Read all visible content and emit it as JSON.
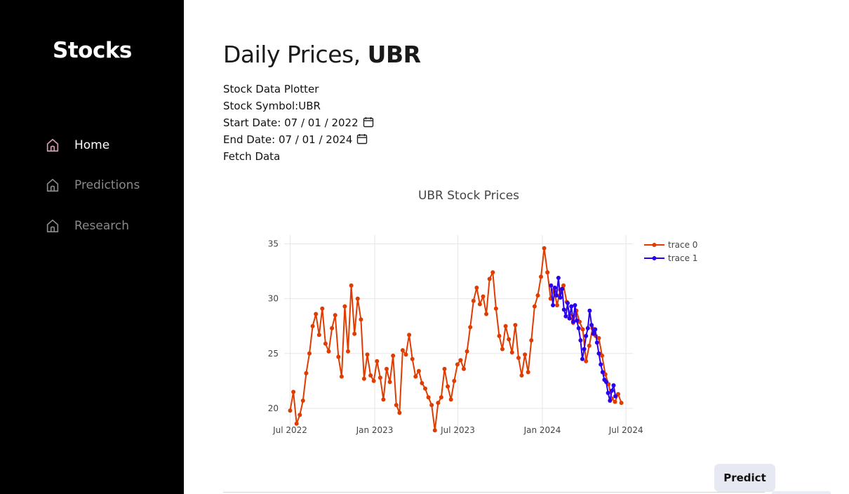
{
  "sidebar": {
    "brand": "Stocks",
    "items": [
      {
        "label": "Home",
        "icon": "home-icon",
        "active": true
      },
      {
        "label": "Predictions",
        "icon": "home-icon",
        "active": false
      },
      {
        "label": "Research",
        "icon": "home-icon",
        "active": false
      }
    ],
    "colors": {
      "background": "#000000",
      "active_icon": "#d79bb4",
      "inactive": "#8a8a8a"
    }
  },
  "main": {
    "title_prefix": "Daily Prices, ",
    "title_symbol": "UBR",
    "plotter_label": "Stock Data Plotter",
    "symbol_label": "Stock Symbol:UBR",
    "start_label": "Start Date: ",
    "start_value": "07 / 01 / 2022",
    "end_label": "End Date: ",
    "end_value": "07 / 01 / 2024",
    "fetch_label": "Fetch Data",
    "predict_label": "Predict"
  },
  "chart_data": {
    "type": "line",
    "title": "UBR Stock Prices",
    "xlabel": "",
    "ylabel": "",
    "ylim": [
      17.5,
      35.8
    ],
    "xlim": [
      "2022-06-18",
      "2024-07-16"
    ],
    "x_ticks": [
      "Jul 2022",
      "Jan 2023",
      "Jul 2023",
      "Jan 2024",
      "Jul 2024"
    ],
    "x_tick_dates": [
      "2022-07-01",
      "2023-01-01",
      "2023-07-01",
      "2024-01-01",
      "2024-07-01"
    ],
    "y_ticks": [
      20,
      25,
      30,
      35
    ],
    "grid": true,
    "legend_position": "top-right",
    "mode": "lines+markers",
    "series": [
      {
        "name": "trace 0",
        "color": "#e03c00",
        "points": [
          [
            "2022-07-01",
            19.8
          ],
          [
            "2022-07-08",
            21.5
          ],
          [
            "2022-07-15",
            18.6
          ],
          [
            "2022-07-22",
            19.4
          ],
          [
            "2022-07-29",
            20.7
          ],
          [
            "2022-08-05",
            23.2
          ],
          [
            "2022-08-12",
            25.0
          ],
          [
            "2022-08-19",
            27.5
          ],
          [
            "2022-08-26",
            28.6
          ],
          [
            "2022-09-02",
            26.7
          ],
          [
            "2022-09-09",
            29.1
          ],
          [
            "2022-09-16",
            25.9
          ],
          [
            "2022-09-23",
            25.2
          ],
          [
            "2022-09-30",
            27.3
          ],
          [
            "2022-10-07",
            28.5
          ],
          [
            "2022-10-14",
            24.7
          ],
          [
            "2022-10-21",
            22.9
          ],
          [
            "2022-10-28",
            29.3
          ],
          [
            "2022-11-04",
            25.2
          ],
          [
            "2022-11-11",
            31.2
          ],
          [
            "2022-11-18",
            26.8
          ],
          [
            "2022-11-25",
            30.0
          ],
          [
            "2022-12-02",
            28.1
          ],
          [
            "2022-12-09",
            22.7
          ],
          [
            "2022-12-16",
            24.9
          ],
          [
            "2022-12-23",
            23.0
          ],
          [
            "2022-12-30",
            22.5
          ],
          [
            "2023-01-06",
            24.3
          ],
          [
            "2023-01-13",
            22.8
          ],
          [
            "2023-01-20",
            20.8
          ],
          [
            "2023-01-27",
            23.6
          ],
          [
            "2023-02-03",
            22.4
          ],
          [
            "2023-02-10",
            24.8
          ],
          [
            "2023-02-17",
            20.3
          ],
          [
            "2023-02-24",
            19.6
          ],
          [
            "2023-03-03",
            25.3
          ],
          [
            "2023-03-10",
            24.9
          ],
          [
            "2023-03-17",
            26.7
          ],
          [
            "2023-03-24",
            24.5
          ],
          [
            "2023-03-31",
            22.9
          ],
          [
            "2023-04-07",
            23.4
          ],
          [
            "2023-04-14",
            22.3
          ],
          [
            "2023-04-21",
            21.8
          ],
          [
            "2023-04-28",
            21.0
          ],
          [
            "2023-05-05",
            20.3
          ],
          [
            "2023-05-12",
            18.0
          ],
          [
            "2023-05-19",
            20.5
          ],
          [
            "2023-05-26",
            21.0
          ],
          [
            "2023-06-02",
            23.6
          ],
          [
            "2023-06-09",
            22.0
          ],
          [
            "2023-06-16",
            20.8
          ],
          [
            "2023-06-23",
            22.5
          ],
          [
            "2023-06-30",
            24.0
          ],
          [
            "2023-07-07",
            24.4
          ],
          [
            "2023-07-14",
            23.6
          ],
          [
            "2023-07-21",
            25.2
          ],
          [
            "2023-07-28",
            27.4
          ],
          [
            "2023-08-04",
            29.8
          ],
          [
            "2023-08-11",
            31.0
          ],
          [
            "2023-08-18",
            29.5
          ],
          [
            "2023-08-25",
            30.2
          ],
          [
            "2023-09-01",
            28.6
          ],
          [
            "2023-09-08",
            31.8
          ],
          [
            "2023-09-15",
            32.4
          ],
          [
            "2023-09-22",
            29.1
          ],
          [
            "2023-09-29",
            26.6
          ],
          [
            "2023-10-06",
            25.4
          ],
          [
            "2023-10-13",
            27.5
          ],
          [
            "2023-10-20",
            26.3
          ],
          [
            "2023-10-27",
            25.1
          ],
          [
            "2023-11-03",
            27.6
          ],
          [
            "2023-11-10",
            24.6
          ],
          [
            "2023-11-17",
            23.0
          ],
          [
            "2023-11-24",
            24.9
          ],
          [
            "2023-12-01",
            23.3
          ],
          [
            "2023-12-08",
            26.2
          ],
          [
            "2023-12-15",
            29.3
          ],
          [
            "2023-12-22",
            30.3
          ],
          [
            "2023-12-29",
            32.0
          ],
          [
            "2024-01-05",
            34.6
          ],
          [
            "2024-01-12",
            32.4
          ],
          [
            "2024-01-19",
            30.0
          ],
          [
            "2024-01-26",
            30.8
          ],
          [
            "2024-02-02",
            29.4
          ],
          [
            "2024-02-09",
            30.8
          ],
          [
            "2024-02-16",
            31.2
          ],
          [
            "2024-02-23",
            29.7
          ],
          [
            "2024-03-01",
            28.5
          ],
          [
            "2024-03-08",
            27.8
          ],
          [
            "2024-03-15",
            28.9
          ],
          [
            "2024-03-22",
            27.9
          ],
          [
            "2024-03-29",
            27.2
          ],
          [
            "2024-04-05",
            24.3
          ],
          [
            "2024-04-12",
            25.7
          ],
          [
            "2024-04-19",
            27.3
          ],
          [
            "2024-04-26",
            26.6
          ],
          [
            "2024-05-03",
            26.4
          ],
          [
            "2024-05-10",
            24.8
          ],
          [
            "2024-05-17",
            23.1
          ],
          [
            "2024-05-24",
            22.2
          ],
          [
            "2024-05-31",
            20.9
          ],
          [
            "2024-06-07",
            20.6
          ],
          [
            "2024-06-14",
            21.3
          ],
          [
            "2024-06-21",
            20.5
          ]
        ]
      },
      {
        "name": "trace 1",
        "color": "#2a00f0",
        "points": [
          [
            "2024-01-20",
            31.2
          ],
          [
            "2024-01-24",
            29.4
          ],
          [
            "2024-01-28",
            31.0
          ],
          [
            "2024-02-01",
            30.3
          ],
          [
            "2024-02-05",
            31.9
          ],
          [
            "2024-02-09",
            30.1
          ],
          [
            "2024-02-13",
            30.9
          ],
          [
            "2024-02-17",
            29.0
          ],
          [
            "2024-02-21",
            28.4
          ],
          [
            "2024-02-25",
            29.6
          ],
          [
            "2024-02-29",
            28.2
          ],
          [
            "2024-03-04",
            29.3
          ],
          [
            "2024-03-08",
            27.9
          ],
          [
            "2024-03-12",
            29.4
          ],
          [
            "2024-03-16",
            28.0
          ],
          [
            "2024-03-20",
            27.3
          ],
          [
            "2024-03-24",
            26.2
          ],
          [
            "2024-03-28",
            24.5
          ],
          [
            "2024-04-01",
            25.4
          ],
          [
            "2024-04-05",
            26.6
          ],
          [
            "2024-04-09",
            27.3
          ],
          [
            "2024-04-13",
            28.9
          ],
          [
            "2024-04-17",
            27.6
          ],
          [
            "2024-04-21",
            26.8
          ],
          [
            "2024-04-25",
            27.2
          ],
          [
            "2024-04-29",
            26.0
          ],
          [
            "2024-05-03",
            25.0
          ],
          [
            "2024-05-07",
            24.0
          ],
          [
            "2024-05-11",
            23.3
          ],
          [
            "2024-05-15",
            22.6
          ],
          [
            "2024-05-19",
            22.4
          ],
          [
            "2024-05-23",
            21.4
          ],
          [
            "2024-05-27",
            20.7
          ],
          [
            "2024-05-31",
            21.6
          ],
          [
            "2024-06-04",
            22.1
          ],
          [
            "2024-06-08",
            21.1
          ]
        ]
      }
    ]
  }
}
